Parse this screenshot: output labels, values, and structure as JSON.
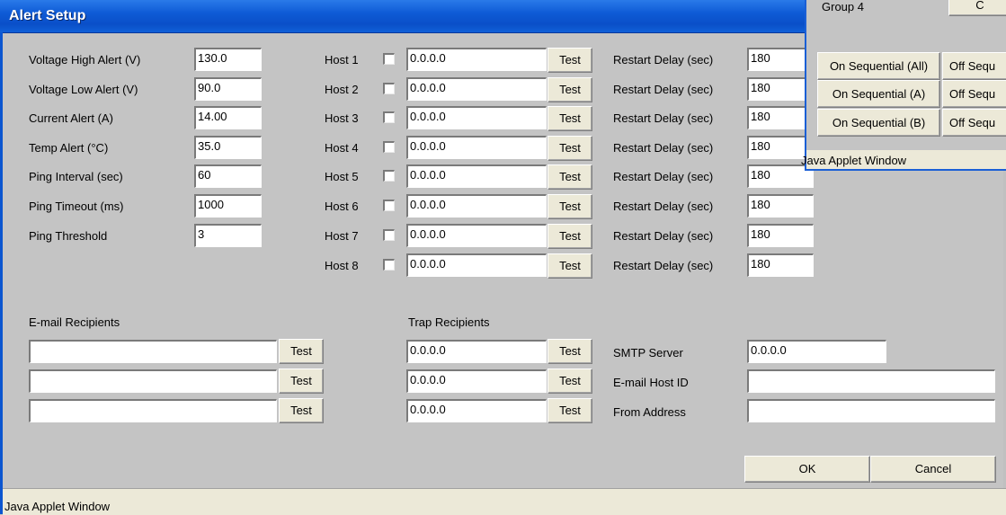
{
  "window": {
    "title": "Alert Setup",
    "status": "Java Applet Window"
  },
  "alerts": [
    {
      "label": "Voltage High Alert (V)",
      "value": "130.0"
    },
    {
      "label": "Voltage Low Alert (V)",
      "value": "90.0"
    },
    {
      "label": "Current Alert (A)",
      "value": "14.00"
    },
    {
      "label": "Temp Alert (°C)",
      "value": "35.0"
    },
    {
      "label": "Ping Interval (sec)",
      "value": "60"
    },
    {
      "label": "Ping Timeout (ms)",
      "value": "1000"
    },
    {
      "label": "Ping Threshold",
      "value": "3"
    }
  ],
  "hosts": [
    {
      "label": "Host 1",
      "checked": false,
      "ip": "0.0.0.0",
      "test": "Test",
      "delay_label": "Restart Delay (sec)",
      "delay": "180"
    },
    {
      "label": "Host 2",
      "checked": false,
      "ip": "0.0.0.0",
      "test": "Test",
      "delay_label": "Restart Delay (sec)",
      "delay": "180"
    },
    {
      "label": "Host 3",
      "checked": false,
      "ip": "0.0.0.0",
      "test": "Test",
      "delay_label": "Restart Delay (sec)",
      "delay": "180"
    },
    {
      "label": "Host 4",
      "checked": false,
      "ip": "0.0.0.0",
      "test": "Test",
      "delay_label": "Restart Delay (sec)",
      "delay": "180"
    },
    {
      "label": "Host 5",
      "checked": false,
      "ip": "0.0.0.0",
      "test": "Test",
      "delay_label": "Restart Delay (sec)",
      "delay": "180"
    },
    {
      "label": "Host 6",
      "checked": false,
      "ip": "0.0.0.0",
      "test": "Test",
      "delay_label": "Restart Delay (sec)",
      "delay": "180"
    },
    {
      "label": "Host 7",
      "checked": false,
      "ip": "0.0.0.0",
      "test": "Test",
      "delay_label": "Restart Delay (sec)",
      "delay": "180"
    },
    {
      "label": "Host 8",
      "checked": false,
      "ip": "0.0.0.0",
      "test": "Test",
      "delay_label": "Restart Delay (sec)",
      "delay": "180"
    }
  ],
  "email": {
    "heading": "E-mail Recipients",
    "recipients": [
      {
        "value": "",
        "test": "Test"
      },
      {
        "value": "",
        "test": "Test"
      },
      {
        "value": "",
        "test": "Test"
      }
    ]
  },
  "trap": {
    "heading": "Trap Recipients",
    "recipients": [
      {
        "value": "0.0.0.0",
        "test": "Test"
      },
      {
        "value": "0.0.0.0",
        "test": "Test"
      },
      {
        "value": "0.0.0.0",
        "test": "Test"
      }
    ]
  },
  "smtp": {
    "server_label": "SMTP Server",
    "server_value": "0.0.0.0",
    "host_id_label": "E-mail Host ID",
    "host_id_value": "",
    "from_label": "From Address",
    "from_value": ""
  },
  "actions": {
    "ok": "OK",
    "cancel": "Cancel"
  },
  "background_window": {
    "group_label": "Group 4",
    "group_button": "C",
    "buttons": [
      {
        "on": "On Sequential (All)",
        "off": "Off Sequ"
      },
      {
        "on": "On Sequential (A)",
        "off": "Off Sequ"
      },
      {
        "on": "On Sequential (B)",
        "off": "Off Sequ"
      }
    ],
    "status": "Java Applet Window"
  }
}
